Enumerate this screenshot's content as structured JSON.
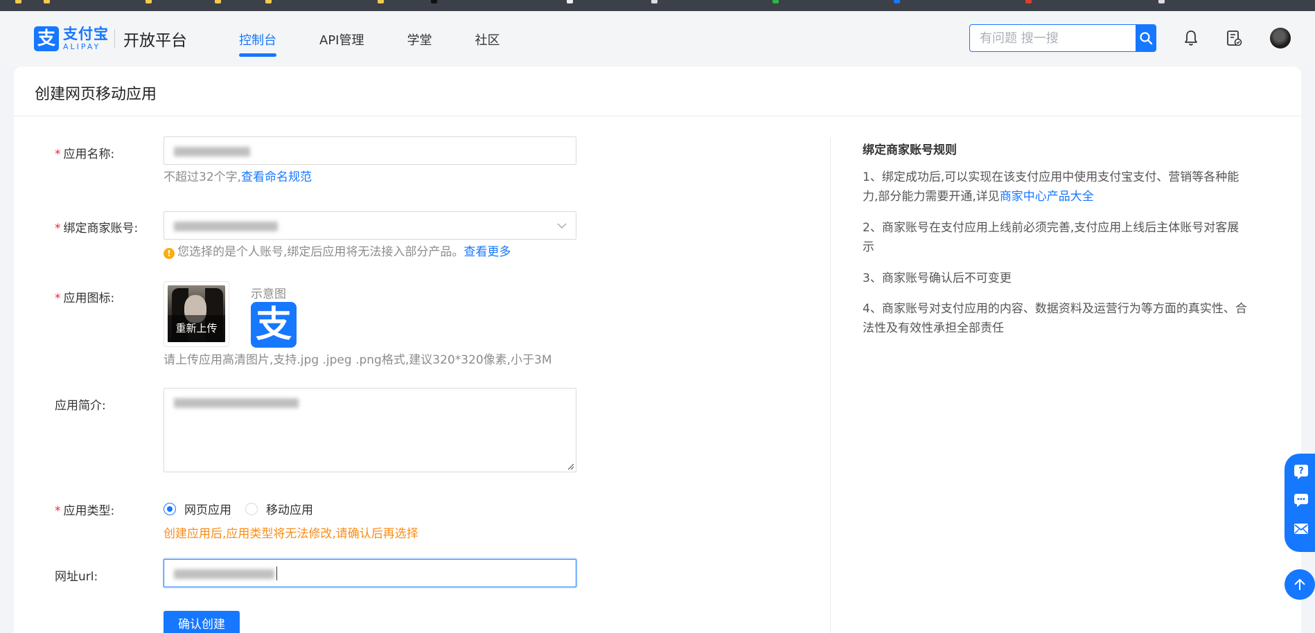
{
  "header": {
    "logo_cn": "支付宝",
    "logo_en": "ALIPAY",
    "logo_glyph": "支",
    "platform": "开放平台",
    "nav": [
      {
        "label": "控制台",
        "active": true
      },
      {
        "label": "API管理",
        "active": false
      },
      {
        "label": "学堂",
        "active": false
      },
      {
        "label": "社区",
        "active": false
      }
    ],
    "search_placeholder": "有问题 搜一搜"
  },
  "page": {
    "title": "创建网页移动应用"
  },
  "form": {
    "name": {
      "label": "应用名称:",
      "required": true,
      "help_prefix": "不超过32个字,",
      "help_link": "查看命名规范"
    },
    "merchant": {
      "label": "绑定商家账号:",
      "required": true,
      "warning": "您选择的是个人账号,绑定后应用将无法接入部分产品。",
      "warning_link": "查看更多"
    },
    "icon": {
      "label": "应用图标:",
      "required": true,
      "reupload_label": "重新上传",
      "sample_label": "示意图",
      "sample_glyph": "支",
      "help": "请上传应用高清图片,支持.jpg .jpeg .png格式,建议320*320像素,小于3M"
    },
    "intro": {
      "label": "应用简介:"
    },
    "type": {
      "label": "应用类型:",
      "required": true,
      "options": [
        {
          "label": "网页应用",
          "checked": true
        },
        {
          "label": "移动应用",
          "checked": false
        }
      ],
      "note": "创建应用后,应用类型将无法修改,请确认后再选择"
    },
    "url": {
      "label": "网址url:"
    },
    "submit_label": "确认创建"
  },
  "rules": {
    "title": "绑定商家账号规则",
    "item1_text": "1、绑定成功后,可以实现在该支付应用中使用支付宝支付、营销等各种能力,部分能力需要开通,详见",
    "item1_link": "商家中心产品大全",
    "item2": "2、商家账号在支付应用上线前必须完善,支付应用上线后主体账号对客展示",
    "item3": "3、商家账号确认后不可变更",
    "item4": "4、商家账号对支付应用的内容、数据资料及运营行为等方面的真实性、合法性及有效性承担全部责任"
  },
  "colors": {
    "brand": "#1677ff",
    "required": "#f5222d",
    "warning": "#faad14",
    "note": "#fa8c16"
  }
}
